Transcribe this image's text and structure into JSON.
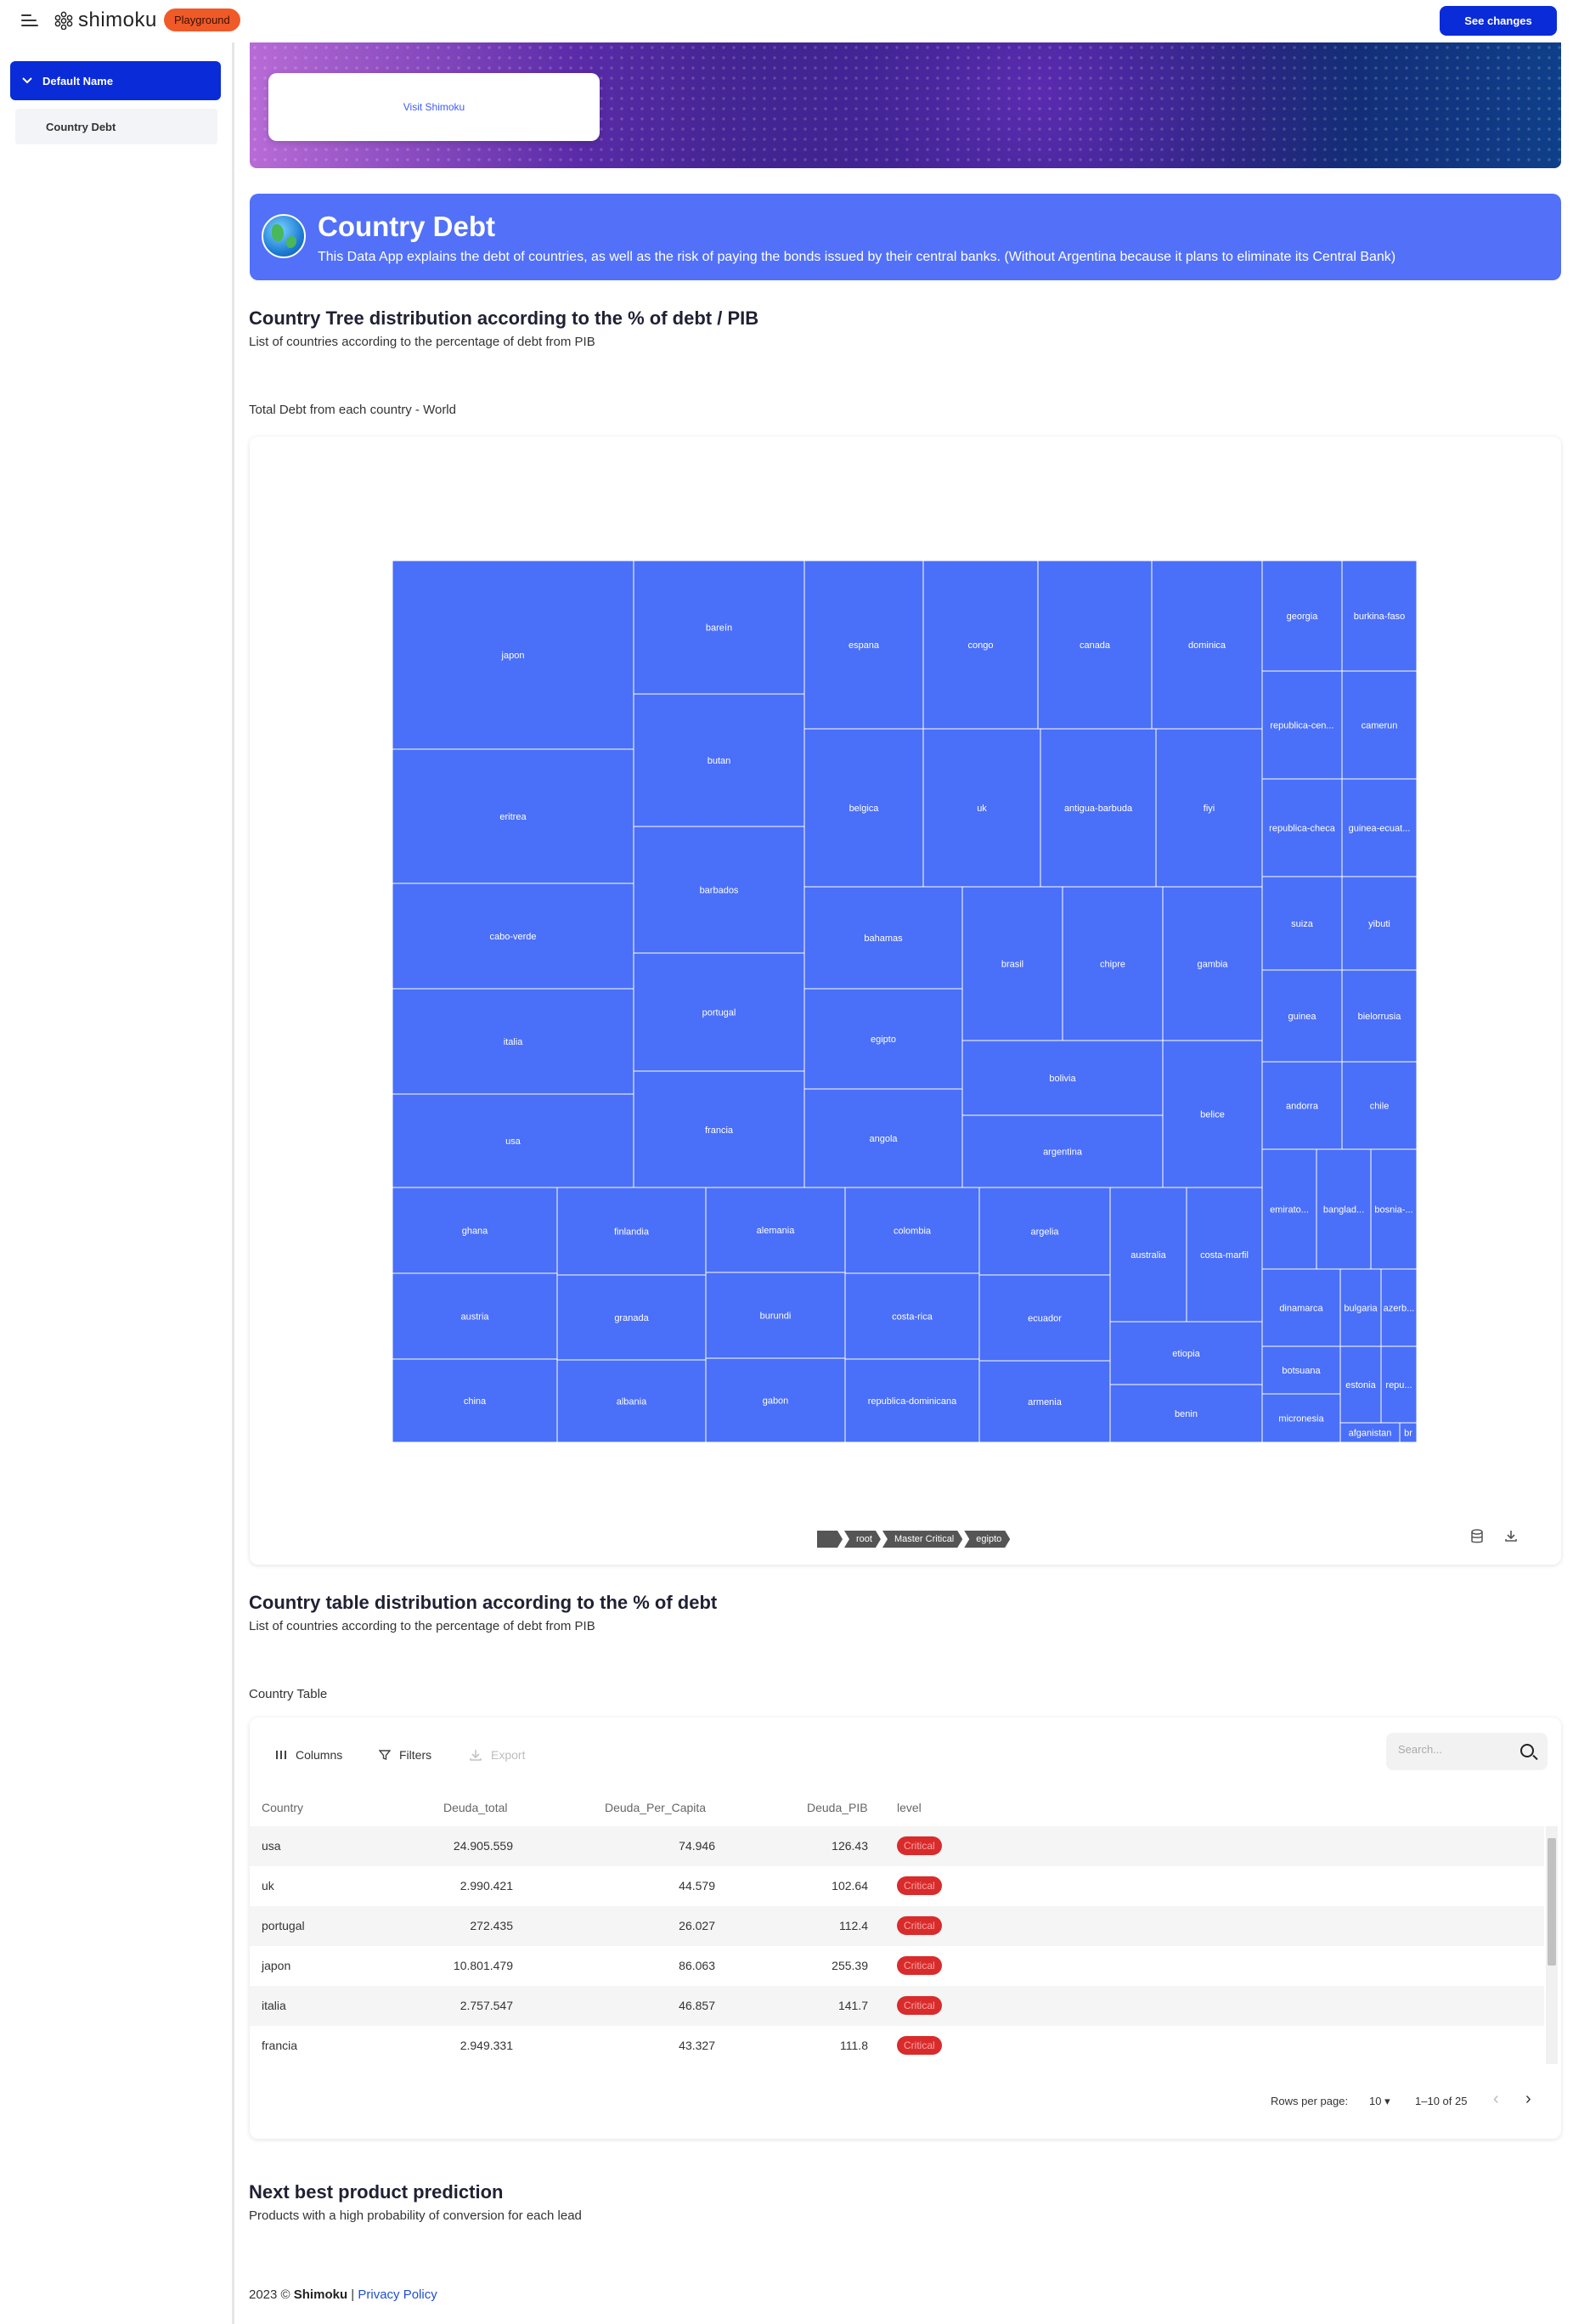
{
  "topbar": {
    "logo_text": "shimoku",
    "badge": "Playground",
    "see_changes": "See changes"
  },
  "sidebar": {
    "group": "Default Name",
    "items": [
      {
        "label": "Country Debt"
      }
    ]
  },
  "hero": {
    "visit_link": "Visit Shimoku"
  },
  "banner": {
    "title": "Country Debt",
    "description": "This Data App explains the debt of countries, as well as the risk of paying the bonds issued by their central banks. (Without Argentina because it plans to eliminate its Central Bank)"
  },
  "section1": {
    "title": "Country Tree distribution according to the % of debt / PIB",
    "subtitle": "List of countries according to the percentage of debt from PIB",
    "card_label": "Total Debt from each country - World"
  },
  "chart_data": {
    "type": "treemap",
    "color": "#4a6ff8",
    "labels": [
      "japon",
      "bareín",
      "espana",
      "congo",
      "canada",
      "dominica",
      "georgia",
      "burkina-faso",
      "eritrea",
      "butan",
      "belgica",
      "uk",
      "antigua-barbuda",
      "fiyi",
      "republica-cen...",
      "camerun",
      "cabo-verde",
      "barbados",
      "bahamas",
      "brasil",
      "chipre",
      "gambia",
      "republica-checa",
      "guinea-ecuat...",
      "italia",
      "portugal",
      "egipto",
      "suiza",
      "yibuti",
      "usa",
      "francia",
      "angola",
      "bolivia",
      "argentina",
      "belice",
      "guinea",
      "bielorrusia",
      "andorra",
      "chile",
      "ghana",
      "finlandia",
      "alemania",
      "colombia",
      "argelia",
      "australia",
      "costa-marfil",
      "emirato...",
      "banglad...",
      "bosnia-...",
      "austria",
      "granada",
      "burundi",
      "costa-rica",
      "ecuador",
      "etiopia",
      "dinamarca",
      "bulgaria",
      "azerb...",
      "china",
      "albania",
      "gabon",
      "republica-dominicana",
      "armenia",
      "benin",
      "botsuana",
      "micronesia",
      "estonia",
      "repu...",
      "afganistan",
      "br"
    ],
    "breadcrumb": [
      "root",
      "Master Critical",
      "egipto"
    ]
  },
  "section2": {
    "title": "Country table distribution according to the % of debt",
    "subtitle": "List of countries according to the percentage of debt from PIB",
    "card_label": "Country Table"
  },
  "table": {
    "toolbar": {
      "columns": "Columns",
      "filters": "Filters",
      "export": "Export"
    },
    "search_placeholder": "Search...",
    "columns": [
      "Country",
      "Deuda_total",
      "Deuda_Per_Capita",
      "Deuda_PIB",
      "level"
    ],
    "rows": [
      {
        "country": "usa",
        "total": "24.905.559",
        "per_capita": "74.946",
        "pib": "126.43",
        "level": "Critical"
      },
      {
        "country": "uk",
        "total": "2.990.421",
        "per_capita": "44.579",
        "pib": "102.64",
        "level": "Critical"
      },
      {
        "country": "portugal",
        "total": "272.435",
        "per_capita": "26.027",
        "pib": "112.4",
        "level": "Critical"
      },
      {
        "country": "japon",
        "total": "10.801.479",
        "per_capita": "86.063",
        "pib": "255.39",
        "level": "Critical"
      },
      {
        "country": "italia",
        "total": "2.757.547",
        "per_capita": "46.857",
        "pib": "141.7",
        "level": "Critical"
      },
      {
        "country": "francia",
        "total": "2.949.331",
        "per_capita": "43.327",
        "pib": "111.8",
        "level": "Critical"
      }
    ],
    "pagination": {
      "rows_per_page_label": "Rows per page:",
      "rows_per_page": "10",
      "range": "1–10 of 25"
    }
  },
  "section3": {
    "title": "Next best product prediction",
    "subtitle": "Products with a high probability of conversion for each lead"
  },
  "footer": {
    "copyright": "2023 ©",
    "brand": "Shimoku",
    "separator": "|",
    "privacy": "Privacy Policy"
  }
}
